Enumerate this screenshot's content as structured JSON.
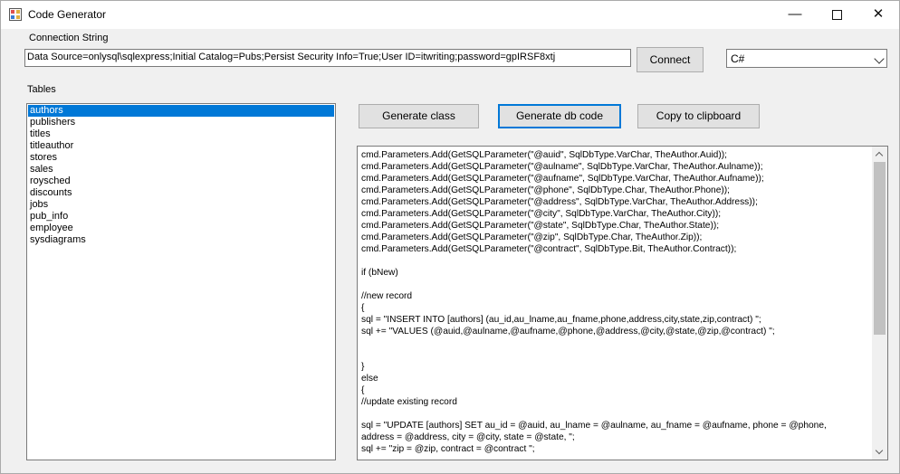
{
  "window": {
    "title": "Code Generator"
  },
  "icons": {
    "app": "code-generator-app-icon",
    "minimize": "minimize-icon",
    "maximize": "maximize-icon",
    "close": "close-icon",
    "dropdown": "chevron-down-icon"
  },
  "connection": {
    "label": "Connection String",
    "value": "Data Source=onlysql\\sqlexpress;Initial Catalog=Pubs;Persist Security Info=True;User ID=itwriting;password=gpIRSF8xtj",
    "connect_label": "Connect"
  },
  "language": {
    "selected": "C#"
  },
  "tables": {
    "label": "Tables",
    "items": [
      "authors",
      "publishers",
      "titles",
      "titleauthor",
      "stores",
      "sales",
      "roysched",
      "discounts",
      "jobs",
      "pub_info",
      "employee",
      "sysdiagrams"
    ],
    "selected_index": 0
  },
  "actions": {
    "generate_class": "Generate class",
    "generate_db_code": "Generate db code",
    "copy_clipboard": "Copy to clipboard"
  },
  "code_lines": [
    "cmd.Parameters.Add(GetSQLParameter(\"@auid\", SqlDbType.VarChar, TheAuthor.Auid));",
    "cmd.Parameters.Add(GetSQLParameter(\"@aulname\", SqlDbType.VarChar, TheAuthor.Aulname));",
    "cmd.Parameters.Add(GetSQLParameter(\"@aufname\", SqlDbType.VarChar, TheAuthor.Aufname));",
    "cmd.Parameters.Add(GetSQLParameter(\"@phone\", SqlDbType.Char, TheAuthor.Phone));",
    "cmd.Parameters.Add(GetSQLParameter(\"@address\", SqlDbType.VarChar, TheAuthor.Address));",
    "cmd.Parameters.Add(GetSQLParameter(\"@city\", SqlDbType.VarChar, TheAuthor.City));",
    "cmd.Parameters.Add(GetSQLParameter(\"@state\", SqlDbType.Char, TheAuthor.State));",
    "cmd.Parameters.Add(GetSQLParameter(\"@zip\", SqlDbType.Char, TheAuthor.Zip));",
    "cmd.Parameters.Add(GetSQLParameter(\"@contract\", SqlDbType.Bit, TheAuthor.Contract));",
    "",
    "if (bNew)",
    "",
    "//new record",
    "{",
    "sql = \"INSERT INTO [authors] (au_id,au_lname,au_fname,phone,address,city,state,zip,contract) \";",
    "sql += \"VALUES (@auid,@aulname,@aufname,@phone,@address,@city,@state,@zip,@contract) \";",
    "",
    "",
    "}",
    "else",
    "{",
    "//update existing record",
    "",
    "sql = \"UPDATE [authors] SET au_id = @auid, au_lname = @aulname, au_fname = @aufname, phone = @phone,",
    "address = @address, city = @city, state = @state, \";",
    "sql += \"zip = @zip, contract = @contract \";"
  ]
}
